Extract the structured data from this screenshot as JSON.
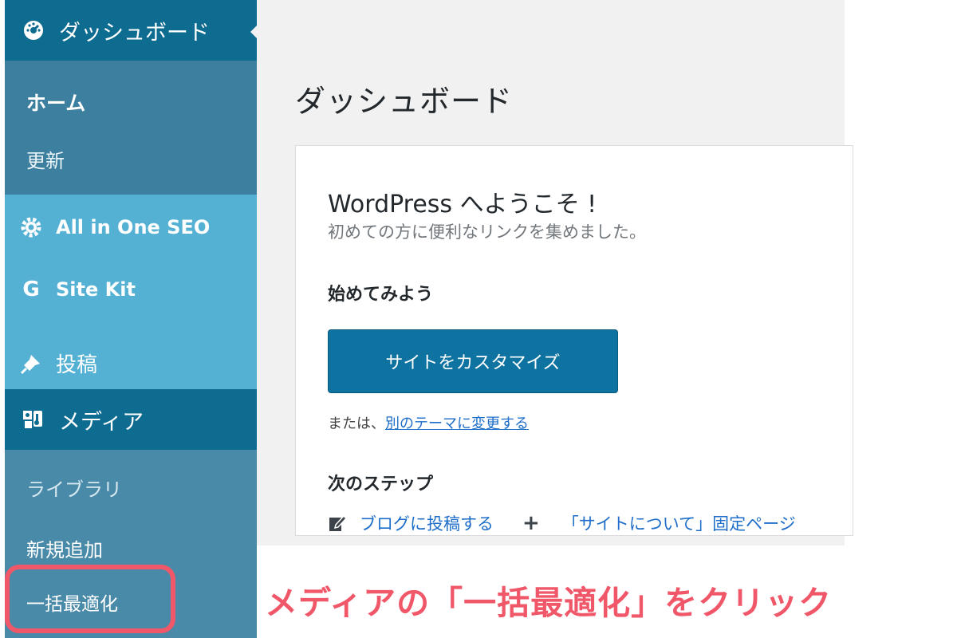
{
  "sidebar": {
    "dashboard": {
      "label": "ダッシュボード",
      "icon": "dashboard-gauge-icon"
    },
    "dashboard_sub": {
      "home": "ホーム",
      "updates": "更新"
    },
    "aioseo": {
      "label": "All in One SEO",
      "icon": "gear-icon"
    },
    "sitekit": {
      "label": "Site Kit",
      "icon": "google-g-icon"
    },
    "posts": {
      "label": "投稿",
      "icon": "pin-icon"
    },
    "media": {
      "label": "メディア",
      "icon": "media-icon"
    },
    "media_sub": {
      "library": "ライブラリ",
      "add_new": "新規追加",
      "bulk_optimize": "一括最適化"
    }
  },
  "main": {
    "page_title": "ダッシュボード",
    "welcome": {
      "title": "WordPress へようこそ !",
      "description": "初めての方に便利なリンクを集めました。",
      "get_started": "始めてみよう",
      "customize_button": "サイトをカスタマイズ",
      "alt_prefix": "または、",
      "alt_link": "別のテーマに変更する",
      "next_steps": "次のステップ",
      "step_blog": "ブログに投稿する",
      "step_about": "「サイトについて」固定ページ"
    }
  },
  "caption": "メディアの「一括最適化」をクリック",
  "colors": {
    "sidebar": "#4a8aa9",
    "active_menu": "#0e6c91",
    "plugin_area": "#55b1d3",
    "button": "#0e73a0",
    "link": "#1e6ec9",
    "highlight": "#f0586a"
  }
}
